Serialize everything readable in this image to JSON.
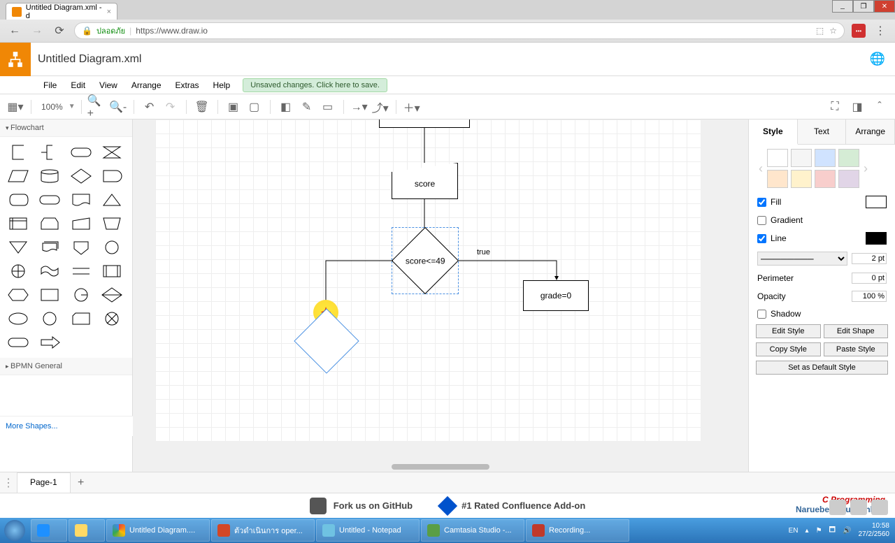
{
  "browser": {
    "tab_title": "Untitled Diagram.xml - d",
    "secure_label": "ปลอดภัย",
    "url": "https://www.draw.io"
  },
  "app": {
    "title": "Untitled Diagram.xml"
  },
  "menu": {
    "file": "File",
    "edit": "Edit",
    "view": "View",
    "arrange": "Arrange",
    "extras": "Extras",
    "help": "Help",
    "unsaved": "Unsaved changes. Click here to save."
  },
  "toolbar": {
    "zoom": "100%"
  },
  "sidebar": {
    "flowchart": "Flowchart",
    "bpmn": "BPMN General",
    "more": "More Shapes..."
  },
  "canvas": {
    "input_label": "score",
    "decision_label": "score<=49",
    "true_label": "true",
    "grade_label": "grade=0"
  },
  "right_panel": {
    "tab_style": "Style",
    "tab_text": "Text",
    "tab_arrange": "Arrange",
    "fill": "Fill",
    "gradient": "Gradient",
    "line": "Line",
    "line_width": "2 pt",
    "perimeter": "Perimeter",
    "perimeter_val": "0 pt",
    "opacity": "Opacity",
    "opacity_val": "100 %",
    "shadow": "Shadow",
    "edit_style": "Edit Style",
    "edit_shape": "Edit Shape",
    "copy_style": "Copy Style",
    "paste_style": "Paste Style",
    "set_default": "Set as Default Style"
  },
  "pages": {
    "page1": "Page-1"
  },
  "footer": {
    "github": "Fork us on GitHub",
    "confluence": "#1 Rated Confluence Add-on",
    "watermark1": "C Programming",
    "watermark2": "Naruebet  Chuabankoh"
  },
  "taskbar": {
    "chrome": "Untitled Diagram....",
    "ppt": "ตัวดำเนินการ oper...",
    "notepad": "Untitled - Notepad",
    "camtasia": "Camtasia Studio -...",
    "recording": "Recording...",
    "lang": "EN",
    "time": "10:58",
    "date": "27/2/2560"
  },
  "colors": {
    "swatches_top": [
      "#ffffff",
      "#f5f5f5",
      "#d0e3ff",
      "#d5ecd5"
    ],
    "swatches_bot": [
      "#ffe6cc",
      "#fff2cc",
      "#f8cecc",
      "#e1d5e7"
    ]
  }
}
